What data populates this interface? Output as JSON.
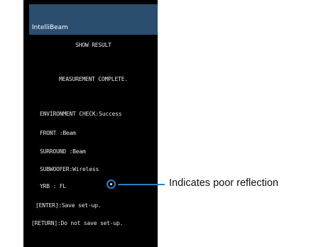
{
  "colors": {
    "screen_background": "#000000",
    "titlebar_background": "#2b4d6e",
    "osd_text": "#e6e6e6",
    "callout_accent": "#2f7ec4"
  },
  "titlebar": {
    "title": "IntelliBeam"
  },
  "osd": {
    "heading": "SHOW RESULT",
    "status": "MEASUREMENT COMPLETE.",
    "results": [
      "ENVIRONMENT CHECK:Success",
      "FRONT    :Beam",
      "SURROUND :Beam",
      "SUBWOOFER:Wireless",
      "YRB   :  FL"
    ],
    "enter_hint": "[ENTER]:Save set-up.",
    "return_hint": "[RETURN]:Do not save set-up."
  },
  "marker": {
    "icon": "poor-reflection-marker-icon"
  },
  "callout": {
    "text": "Indicates poor reflection"
  }
}
